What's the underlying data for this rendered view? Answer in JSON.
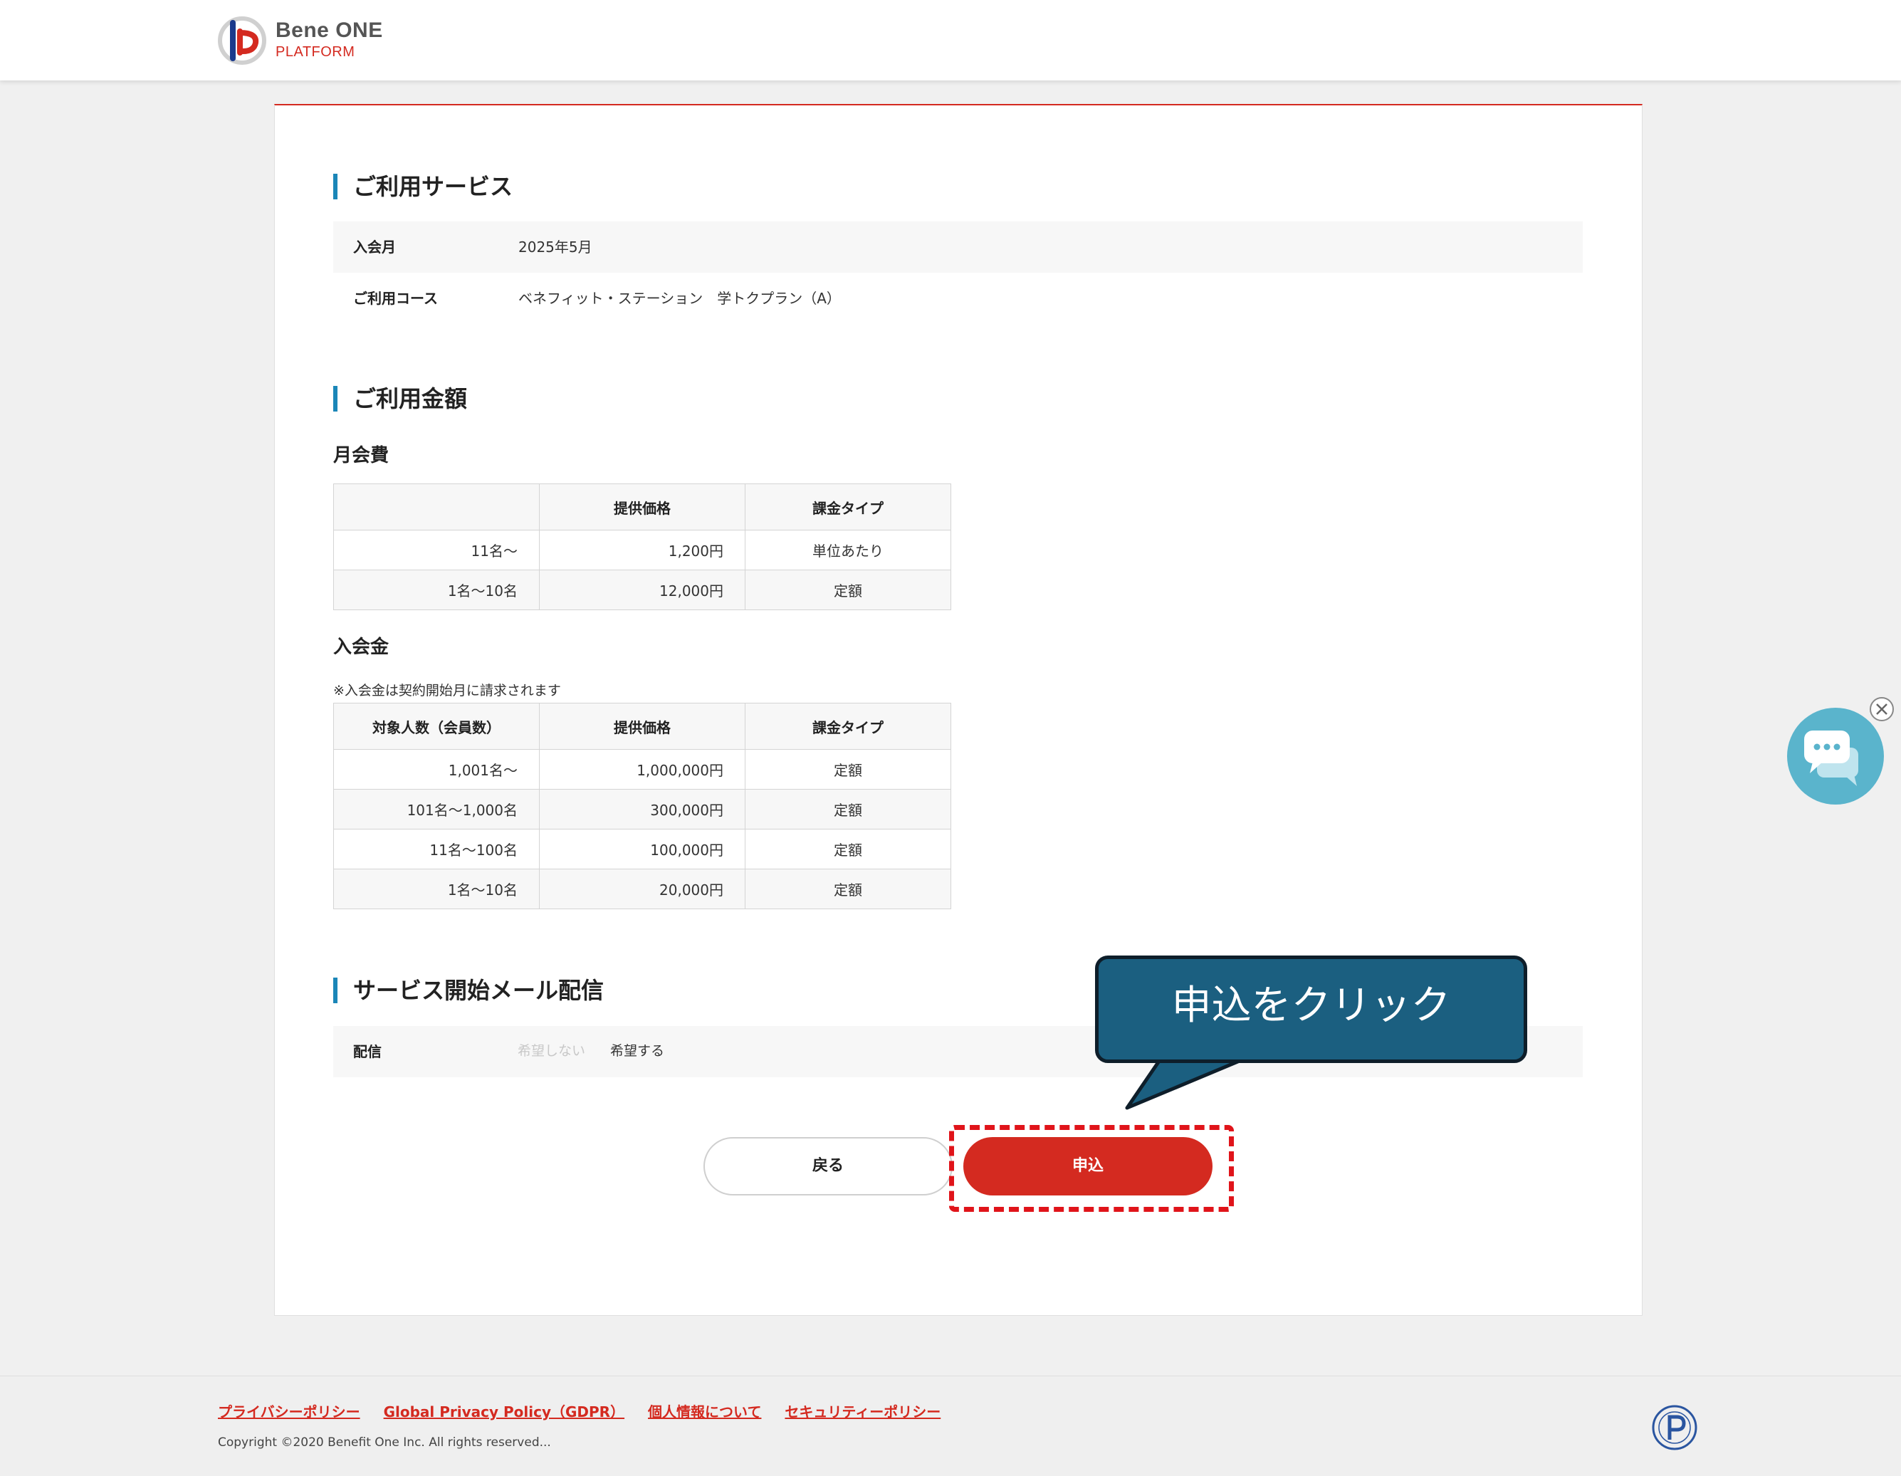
{
  "brand": {
    "name": "Bene ONE",
    "sub": "PLATFORM"
  },
  "service": {
    "title": "ご利用サービス",
    "rows": [
      {
        "label": "入会月",
        "value": "2025年5月"
      },
      {
        "label": "ご利用コース",
        "value": "ベネフィット・ステーション　学トクプラン（A）"
      }
    ]
  },
  "fees": {
    "title": "ご利用金額",
    "monthly": {
      "title": "月会費",
      "headers": [
        "",
        "提供価格",
        "課金タイプ"
      ],
      "rows": [
        [
          "11名～",
          "1,200円",
          "単位あたり"
        ],
        [
          "1名～10名",
          "12,000円",
          "定額"
        ]
      ]
    },
    "entry": {
      "title": "入会金",
      "note": "※入会金は契約開始月に請求されます",
      "headers": [
        "対象人数（会員数）",
        "提供価格",
        "課金タイプ"
      ],
      "rows": [
        [
          "1,001名～",
          "1,000,000円",
          "定額"
        ],
        [
          "101名～1,000名",
          "300,000円",
          "定額"
        ],
        [
          "11名～100名",
          "100,000円",
          "定額"
        ],
        [
          "1名～10名",
          "20,000円",
          "定額"
        ]
      ]
    }
  },
  "mail": {
    "title": "サービス開始メール配信",
    "label": "配信",
    "option_off": "希望しない",
    "option_on": "希望する"
  },
  "buttons": {
    "back": "戻る",
    "apply": "申込"
  },
  "callout": {
    "text": "申込をクリック"
  },
  "footer": {
    "links": [
      "プライバシーポリシー",
      "Global Privacy Policy（GDPR）",
      "個人情報について",
      "セキュリティーポリシー"
    ],
    "copyright": "Copyright ©2020 Benefit One Inc. All rights reserved..."
  },
  "colors": {
    "accent": "#d42a20",
    "section_bar": "#1b86b8",
    "callout": "#1b5f80"
  }
}
